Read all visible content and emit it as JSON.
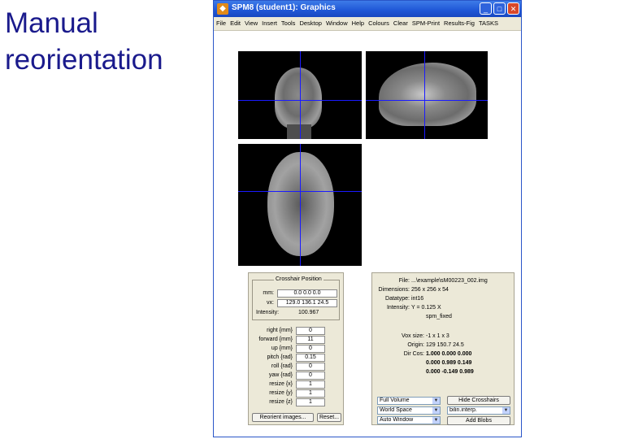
{
  "slide": {
    "title_line1": "Manual",
    "title_line2": "reorientation"
  },
  "window": {
    "title": "SPM8 (student1): Graphics",
    "icon_glyph": "◆",
    "minimize": "_",
    "maximize": "□",
    "close": "✕",
    "menu": [
      "File",
      "Edit",
      "View",
      "Insert",
      "Tools",
      "Desktop",
      "Window",
      "Help",
      "Colours",
      "Clear",
      "SPM-Print",
      "Results-Fig",
      "TASKS"
    ]
  },
  "reorient_panel": {
    "crosshair_title": "Crosshair Position",
    "mm_label": "mm:",
    "mm_value": "0.0 0.0 0.0",
    "vx_label": "vx:",
    "vx_value": "129.0 136.1 24.5",
    "intensity_label": "Intensity:",
    "intensity_value": "100.967",
    "params": [
      {
        "label": "right  {mm}",
        "value": "0"
      },
      {
        "label": "forward  {mm}",
        "value": "11"
      },
      {
        "label": "up  {mm}",
        "value": "0"
      },
      {
        "label": "pitch  {rad}",
        "value": "0.15"
      },
      {
        "label": "roll  {rad}",
        "value": "0"
      },
      {
        "label": "yaw  {rad}",
        "value": "0"
      },
      {
        "label": "resize  {x}",
        "value": "1"
      },
      {
        "label": "resize  {y}",
        "value": "1"
      },
      {
        "label": "resize  {z}",
        "value": "1"
      }
    ],
    "reorient_button": "Reorient images...",
    "reset_button": "Reset..."
  },
  "info_panel": {
    "file_label": "File:",
    "file_value": "...\\example\\sM00223_002.img",
    "dims_label": "Dimensions:",
    "dims_value": "256 x 256 x 54",
    "datatype_label": "Datatype:",
    "datatype_value": "int16",
    "intensity_label": "Intensity:",
    "intensity_value": "Y = 0.125 X",
    "space_value": "spm_fixed",
    "vox_label": "Vox size:",
    "vox_value": "-1 x 1 x 3",
    "origin_label": "Origin:",
    "origin_value": "129 150.7 24.5",
    "dircos_label": "Dir Cos:",
    "dircos_rows": [
      "1.000  0.000  0.000",
      "0.000  0.989  0.149",
      "0.000 -0.149  0.989"
    ]
  },
  "controls": {
    "volume_select": "Full Volume",
    "space_select": "World Space",
    "window_select": "Auto Window",
    "interp_select": "bilin.interp.",
    "hide_crosshairs": "Hide Crosshairs",
    "add_blobs": "Add Blobs"
  },
  "colors": {
    "crosshair": "#1a1aff",
    "title_text": "#1a1a8c",
    "panel_bg": "#ece9d8"
  }
}
